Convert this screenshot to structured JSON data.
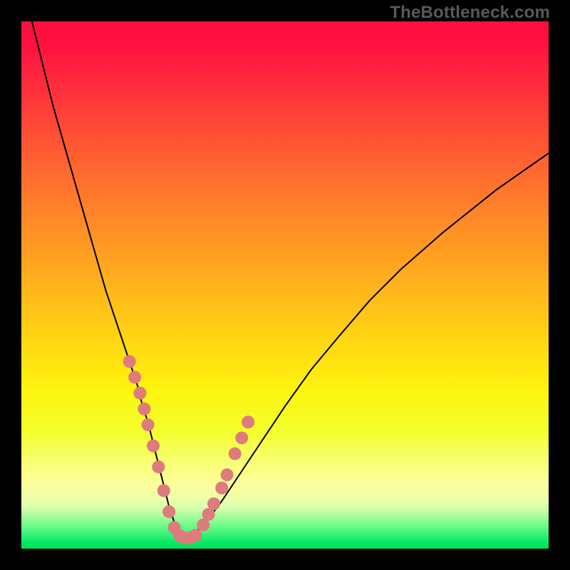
{
  "attribution": "TheBottleneck.com",
  "chart_data": {
    "type": "line",
    "title": "",
    "xlabel": "",
    "ylabel": "",
    "xlim": [
      0,
      100
    ],
    "ylim": [
      0,
      100
    ],
    "curve": {
      "x": [
        2,
        4,
        6,
        8,
        10,
        12,
        14,
        16,
        18,
        20,
        22,
        23,
        24,
        25,
        26,
        27,
        28,
        29,
        30,
        31,
        32,
        33,
        35,
        38,
        42,
        46,
        50,
        55,
        60,
        66,
        72,
        80,
        90,
        100
      ],
      "y": [
        100,
        92,
        84,
        77,
        70,
        63,
        56,
        49,
        43,
        37,
        31,
        27,
        24,
        20,
        16,
        12,
        8,
        5,
        3,
        2,
        2,
        3,
        5,
        9,
        15,
        21,
        27,
        34,
        40,
        47,
        53,
        60,
        68,
        75
      ]
    },
    "markers": {
      "x": [
        20.5,
        21.5,
        22.5,
        23.3,
        24.0,
        25.0,
        26.0,
        27.0,
        28.0,
        29.0,
        30.0,
        31.0,
        32.0,
        33.0,
        34.5,
        35.5,
        36.5,
        38.0,
        39.0,
        40.5,
        41.8,
        43.0
      ],
      "y": [
        35.5,
        32.5,
        29.5,
        26.5,
        23.5,
        19.5,
        15.5,
        11.0,
        7.0,
        4.0,
        2.5,
        2.0,
        2.0,
        2.5,
        4.5,
        6.5,
        8.5,
        11.5,
        14.0,
        18.0,
        21.0,
        24.0
      ]
    },
    "gradient_stops": [
      {
        "pos": 0,
        "color": "#ff0f3d"
      },
      {
        "pos": 50,
        "color": "#ffb31c"
      },
      {
        "pos": 78,
        "color": "#f3ff2e"
      },
      {
        "pos": 100,
        "color": "#00e05c"
      }
    ]
  }
}
